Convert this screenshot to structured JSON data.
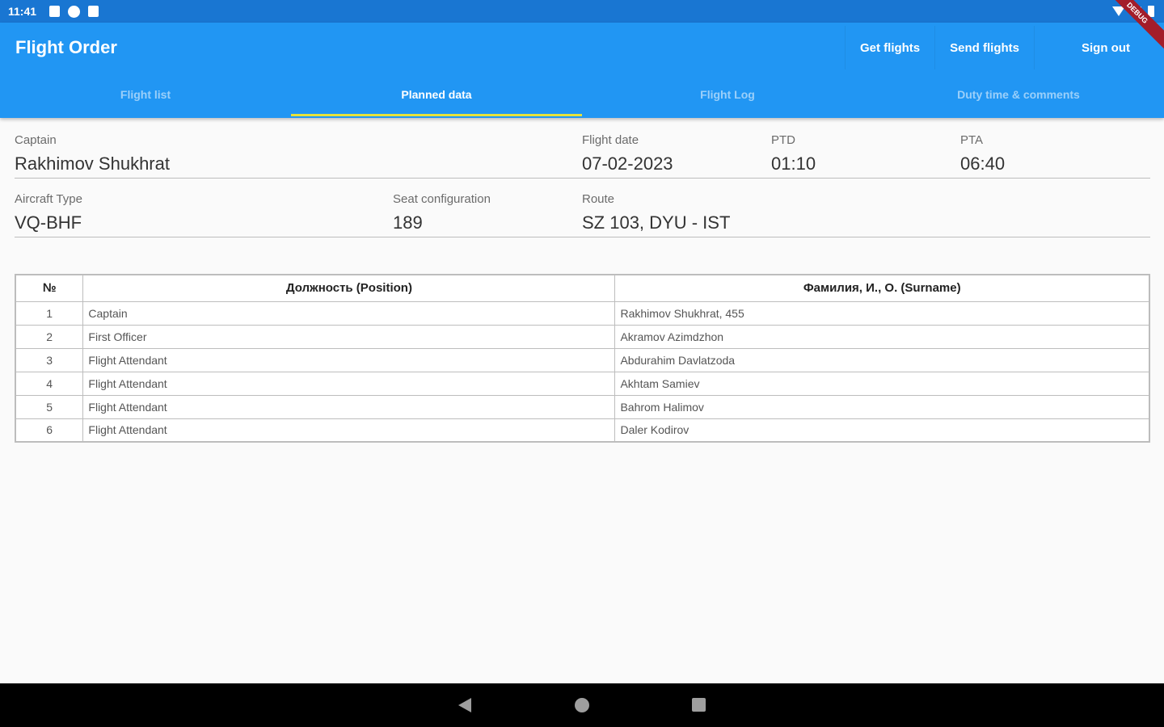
{
  "status_bar": {
    "time": "11:41"
  },
  "app_bar": {
    "title": "Flight Order",
    "actions": [
      "Get flights",
      "Send flights",
      "Sign out"
    ],
    "tabs": [
      "Flight list",
      "Planned data",
      "Flight Log",
      "Duty time & comments"
    ],
    "active_tab": "Planned data"
  },
  "flight_info": {
    "captain_label": "Captain",
    "captain": "Rakhimov Shukhrat",
    "flight_date_label": "Flight date",
    "flight_date": "07-02-2023",
    "ptd_label": "PTD",
    "ptd": "01:10",
    "pta_label": "PTA",
    "pta": "06:40",
    "aircraft_type_label": "Aircraft Type",
    "aircraft_type": "VQ-BHF",
    "seat_config_label": "Seat configuration",
    "seat_config": "189",
    "route_label": "Route",
    "route": "SZ 103, DYU - IST"
  },
  "crew_table": {
    "headers": [
      "№",
      "Должность (Position)",
      "Фамилия, И., О. (Surname)"
    ],
    "rows": [
      [
        "1",
        "Captain",
        "Rakhimov Shukhrat, 455"
      ],
      [
        "2",
        "First Officer",
        "Akramov Azimdzhon"
      ],
      [
        "3",
        "Flight Attendant",
        "Abdurahim Davlatzoda"
      ],
      [
        "4",
        "Flight Attendant",
        "Akhtam Samiev"
      ],
      [
        "5",
        "Flight Attendant",
        "Bahrom Halimov"
      ],
      [
        "6",
        "Flight Attendant",
        "Daler Kodirov"
      ]
    ]
  },
  "colors": {
    "app_bar": "#2196f3",
    "status_bar": "#1976d2",
    "tab_indicator": "#e6e23a"
  }
}
